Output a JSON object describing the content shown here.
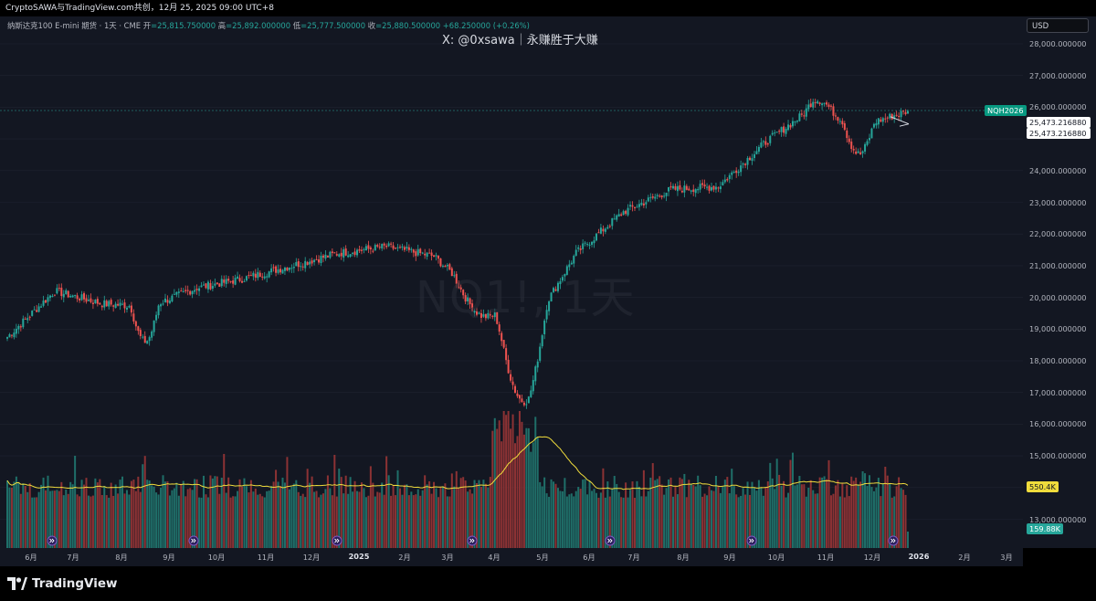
{
  "topline": "CryptoSAWA与TradingView.com共创，12月 25, 2025 09:00 UTC+8",
  "legend": {
    "symbol": "纳斯达克100 E-mini 期货 · 1天 · CME",
    "open_label": "开",
    "open": "=25,815.750000",
    "high_label": "高",
    "high": "=25,892.000000",
    "low_label": "低",
    "low": "=25,777.500000",
    "close_label": "收",
    "close": "=25,880.500000",
    "change": "+68.250000 (+0.26%)"
  },
  "watermark_handle": "X: @0xsawa｜永赚胜于大赚",
  "symbol_watermark": "NQ1!, 1天",
  "currency": "USD",
  "price_axis": [
    "28,000.000000",
    "27,000.000000",
    "26,000.000000",
    "24,000.000000",
    "23,000.000000",
    "22,000.000000",
    "21,000.000000",
    "20,000.000000",
    "19,000.000000",
    "18,000.000000",
    "17,000.000000",
    "16,000.000000",
    "15,000.000000",
    "13,000.000000"
  ],
  "tags": {
    "symbol": "NQH2026",
    "price_1": "25,473.216880",
    "price_2": "25,473.216880",
    "vol_ma": "550.4K",
    "vol": "159.88K"
  },
  "time_axis": [
    "6月",
    "7月",
    "8月",
    "9月",
    "10月",
    "11月",
    "12月",
    "2025",
    "2月",
    "3月",
    "4月",
    "5月",
    "6月",
    "7月",
    "8月",
    "9月",
    "10月",
    "11月",
    "12月",
    "2026",
    "2月",
    "3月"
  ],
  "logo_text": "TradingView",
  "colors": {
    "up": "#26a69a",
    "down": "#ef5350",
    "volume_ma": "#f0dc3c",
    "background": "#131722"
  },
  "chart_data": {
    "type": "candlestick",
    "x_range": [
      "2024-05-20",
      "2025-12-24"
    ],
    "ylim": [
      13000,
      28500
    ],
    "monthly_close": [
      {
        "month": "2024-05",
        "close": 18750
      },
      {
        "month": "2024-06",
        "close": 20200
      },
      {
        "month": "2024-07",
        "close": 19800
      },
      {
        "month": "2024-08",
        "close": 19700
      },
      {
        "month": "2024-09",
        "close": 20300
      },
      {
        "month": "2024-10",
        "close": 20600
      },
      {
        "month": "2024-11",
        "close": 21000
      },
      {
        "month": "2024-12",
        "close": 21400
      },
      {
        "month": "2025-01",
        "close": 21600
      },
      {
        "month": "2025-02",
        "close": 21300
      },
      {
        "month": "2025-03",
        "close": 19900
      },
      {
        "month": "2025-04",
        "close": 18900
      },
      {
        "month": "2025-05",
        "close": 21400
      },
      {
        "month": "2025-06",
        "close": 22700
      },
      {
        "month": "2025-07",
        "close": 23400
      },
      {
        "month": "2025-08",
        "close": 23500
      },
      {
        "month": "2025-09",
        "close": 24900
      },
      {
        "month": "2025-10",
        "close": 26000
      },
      {
        "month": "2025-11",
        "close": 25400
      },
      {
        "month": "2025-12",
        "close": 25880
      }
    ],
    "last_close": 25880.5,
    "volume_ma_last": "550.4K",
    "volume_last": "159.88K"
  }
}
